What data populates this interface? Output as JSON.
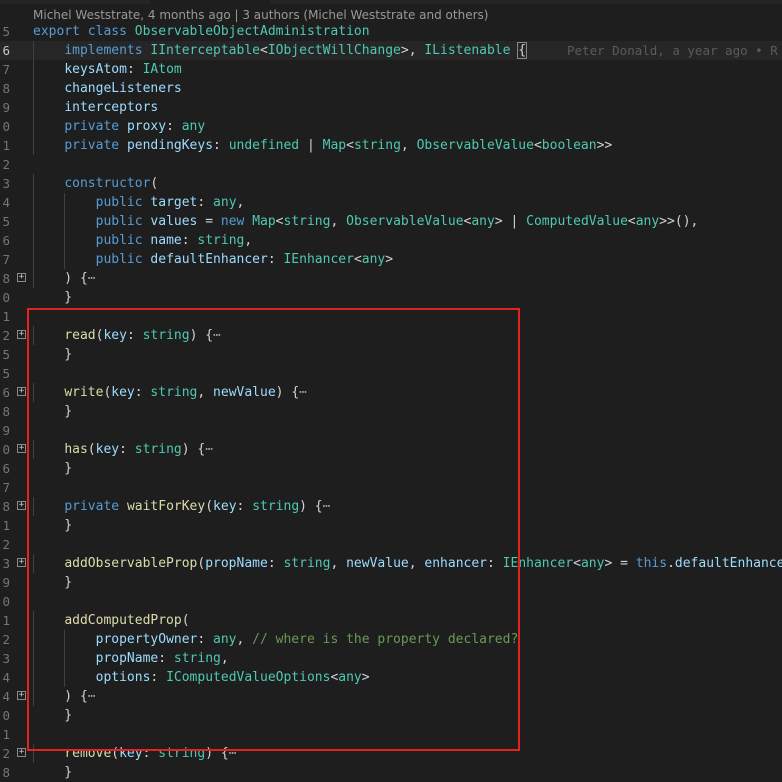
{
  "codelens": {
    "text": "Michel Weststrate, 4 months ago | 3 authors (Michel Weststrate and others)"
  },
  "blame": {
    "text": "Peter Donald, a year ago • R"
  },
  "colors": {
    "highlight_box": "#e52222",
    "background": "#1e1e1e"
  },
  "lines": [
    {
      "num": "5",
      "fold": false,
      "tokens": [
        [
          "k",
          "export "
        ],
        [
          "k",
          "class "
        ],
        [
          "t",
          "ObservableObjectAdministration"
        ]
      ]
    },
    {
      "num": "6",
      "fold": false,
      "current": true,
      "tokens": [
        [
          "p",
          "    "
        ],
        [
          "k",
          "implements "
        ],
        [
          "t",
          "IInterceptable"
        ],
        [
          "p",
          "<"
        ],
        [
          "t",
          "IObjectWillChange"
        ],
        [
          "p",
          ">, "
        ],
        [
          "t",
          "IListenable "
        ],
        [
          "cur",
          "{"
        ]
      ]
    },
    {
      "num": "7",
      "fold": false,
      "tokens": [
        [
          "p",
          "    "
        ],
        [
          "v",
          "keysAtom"
        ],
        [
          "p",
          ": "
        ],
        [
          "t",
          "IAtom"
        ]
      ]
    },
    {
      "num": "8",
      "fold": false,
      "tokens": [
        [
          "p",
          "    "
        ],
        [
          "v",
          "changeListeners"
        ]
      ]
    },
    {
      "num": "9",
      "fold": false,
      "tokens": [
        [
          "p",
          "    "
        ],
        [
          "v",
          "interceptors"
        ]
      ]
    },
    {
      "num": "0",
      "fold": false,
      "tokens": [
        [
          "p",
          "    "
        ],
        [
          "k",
          "private "
        ],
        [
          "v",
          "proxy"
        ],
        [
          "p",
          ": "
        ],
        [
          "t",
          "any"
        ]
      ]
    },
    {
      "num": "1",
      "fold": false,
      "tokens": [
        [
          "p",
          "    "
        ],
        [
          "k",
          "private "
        ],
        [
          "v",
          "pendingKeys"
        ],
        [
          "p",
          ": "
        ],
        [
          "t",
          "undefined"
        ],
        [
          "p",
          " | "
        ],
        [
          "t",
          "Map"
        ],
        [
          "p",
          "<"
        ],
        [
          "t",
          "string"
        ],
        [
          "p",
          ", "
        ],
        [
          "t",
          "ObservableValue"
        ],
        [
          "p",
          "<"
        ],
        [
          "t",
          "boolean"
        ],
        [
          "p",
          ">>"
        ]
      ]
    },
    {
      "num": "2",
      "fold": false,
      "tokens": []
    },
    {
      "num": "3",
      "fold": false,
      "tokens": [
        [
          "p",
          "    "
        ],
        [
          "k",
          "constructor"
        ],
        [
          "p",
          "("
        ]
      ]
    },
    {
      "num": "4",
      "fold": false,
      "tokens": [
        [
          "p",
          "        "
        ],
        [
          "k",
          "public "
        ],
        [
          "v",
          "target"
        ],
        [
          "p",
          ": "
        ],
        [
          "t",
          "any"
        ],
        [
          "p",
          ","
        ]
      ]
    },
    {
      "num": "5",
      "fold": false,
      "tokens": [
        [
          "p",
          "        "
        ],
        [
          "k",
          "public "
        ],
        [
          "v",
          "values"
        ],
        [
          "p",
          " = "
        ],
        [
          "k",
          "new "
        ],
        [
          "t",
          "Map"
        ],
        [
          "p",
          "<"
        ],
        [
          "t",
          "string"
        ],
        [
          "p",
          ", "
        ],
        [
          "t",
          "ObservableValue"
        ],
        [
          "p",
          "<"
        ],
        [
          "t",
          "any"
        ],
        [
          "p",
          "> | "
        ],
        [
          "t",
          "ComputedValue"
        ],
        [
          "p",
          "<"
        ],
        [
          "t",
          "any"
        ],
        [
          "p",
          ">>(),"
        ]
      ]
    },
    {
      "num": "6",
      "fold": false,
      "tokens": [
        [
          "p",
          "        "
        ],
        [
          "k",
          "public "
        ],
        [
          "v",
          "name"
        ],
        [
          "p",
          ": "
        ],
        [
          "t",
          "string"
        ],
        [
          "p",
          ","
        ]
      ]
    },
    {
      "num": "7",
      "fold": false,
      "tokens": [
        [
          "p",
          "        "
        ],
        [
          "k",
          "public "
        ],
        [
          "v",
          "defaultEnhancer"
        ],
        [
          "p",
          ": "
        ],
        [
          "t",
          "IEnhancer"
        ],
        [
          "p",
          "<"
        ],
        [
          "t",
          "any"
        ],
        [
          "p",
          ">"
        ]
      ]
    },
    {
      "num": "8",
      "fold": true,
      "tokens": [
        [
          "p",
          "    ) {"
        ],
        [
          "ell",
          "⋯"
        ]
      ]
    },
    {
      "num": "0",
      "fold": false,
      "tokens": [
        [
          "p",
          "    }"
        ]
      ]
    },
    {
      "num": "1",
      "fold": false,
      "tokens": []
    },
    {
      "num": "2",
      "fold": true,
      "tokens": [
        [
          "p",
          "    "
        ],
        [
          "f",
          "read"
        ],
        [
          "p",
          "("
        ],
        [
          "v",
          "key"
        ],
        [
          "p",
          ": "
        ],
        [
          "t",
          "string"
        ],
        [
          "p",
          ") {"
        ],
        [
          "ell",
          "⋯"
        ]
      ]
    },
    {
      "num": "5",
      "fold": false,
      "tokens": [
        [
          "p",
          "    }"
        ]
      ]
    },
    {
      "num": "5",
      "fold": false,
      "tokens": []
    },
    {
      "num": "6",
      "fold": true,
      "tokens": [
        [
          "p",
          "    "
        ],
        [
          "f",
          "write"
        ],
        [
          "p",
          "("
        ],
        [
          "v",
          "key"
        ],
        [
          "p",
          ": "
        ],
        [
          "t",
          "string"
        ],
        [
          "p",
          ", "
        ],
        [
          "v",
          "newValue"
        ],
        [
          "p",
          ") {"
        ],
        [
          "ell",
          "⋯"
        ]
      ]
    },
    {
      "num": "8",
      "fold": false,
      "tokens": [
        [
          "p",
          "    }"
        ]
      ]
    },
    {
      "num": "9",
      "fold": false,
      "tokens": []
    },
    {
      "num": "0",
      "fold": true,
      "tokens": [
        [
          "p",
          "    "
        ],
        [
          "f",
          "has"
        ],
        [
          "p",
          "("
        ],
        [
          "v",
          "key"
        ],
        [
          "p",
          ": "
        ],
        [
          "t",
          "string"
        ],
        [
          "p",
          ") {"
        ],
        [
          "ell",
          "⋯"
        ]
      ]
    },
    {
      "num": "6",
      "fold": false,
      "tokens": [
        [
          "p",
          "    }"
        ]
      ]
    },
    {
      "num": "7",
      "fold": false,
      "tokens": []
    },
    {
      "num": "8",
      "fold": true,
      "tokens": [
        [
          "p",
          "    "
        ],
        [
          "k",
          "private "
        ],
        [
          "f",
          "waitForKey"
        ],
        [
          "p",
          "("
        ],
        [
          "v",
          "key"
        ],
        [
          "p",
          ": "
        ],
        [
          "t",
          "string"
        ],
        [
          "p",
          ") {"
        ],
        [
          "ell",
          "⋯"
        ]
      ]
    },
    {
      "num": "1",
      "fold": false,
      "tokens": [
        [
          "p",
          "    }"
        ]
      ]
    },
    {
      "num": "2",
      "fold": false,
      "tokens": []
    },
    {
      "num": "3",
      "fold": true,
      "tokens": [
        [
          "p",
          "    "
        ],
        [
          "f",
          "addObservableProp"
        ],
        [
          "p",
          "("
        ],
        [
          "v",
          "propName"
        ],
        [
          "p",
          ": "
        ],
        [
          "t",
          "string"
        ],
        [
          "p",
          ", "
        ],
        [
          "v",
          "newValue"
        ],
        [
          "p",
          ", "
        ],
        [
          "v",
          "enhancer"
        ],
        [
          "p",
          ": "
        ],
        [
          "t",
          "IEnhancer"
        ],
        [
          "p",
          "<"
        ],
        [
          "t",
          "any"
        ],
        [
          "p",
          "> = "
        ],
        [
          "k",
          "this"
        ],
        [
          "p",
          "."
        ],
        [
          "v",
          "defaultEnhancer"
        ],
        [
          "p",
          ")"
        ]
      ]
    },
    {
      "num": "9",
      "fold": false,
      "tokens": [
        [
          "p",
          "    }"
        ]
      ]
    },
    {
      "num": "0",
      "fold": false,
      "tokens": []
    },
    {
      "num": "1",
      "fold": false,
      "tokens": [
        [
          "p",
          "    "
        ],
        [
          "f",
          "addComputedProp"
        ],
        [
          "p",
          "("
        ]
      ]
    },
    {
      "num": "2",
      "fold": false,
      "tokens": [
        [
          "p",
          "        "
        ],
        [
          "v",
          "propertyOwner"
        ],
        [
          "p",
          ": "
        ],
        [
          "t",
          "any"
        ],
        [
          "p",
          ", "
        ],
        [
          "c",
          "// where is the property declared?"
        ]
      ]
    },
    {
      "num": "3",
      "fold": false,
      "tokens": [
        [
          "p",
          "        "
        ],
        [
          "v",
          "propName"
        ],
        [
          "p",
          ": "
        ],
        [
          "t",
          "string"
        ],
        [
          "p",
          ","
        ]
      ]
    },
    {
      "num": "4",
      "fold": false,
      "tokens": [
        [
          "p",
          "        "
        ],
        [
          "v",
          "options"
        ],
        [
          "p",
          ": "
        ],
        [
          "t",
          "IComputedValueOptions"
        ],
        [
          "p",
          "<"
        ],
        [
          "t",
          "any"
        ],
        [
          "p",
          ">"
        ]
      ]
    },
    {
      "num": "4",
      "fold": true,
      "tokens": [
        [
          "p",
          "    ) {"
        ],
        [
          "ell",
          "⋯"
        ]
      ]
    },
    {
      "num": "0",
      "fold": false,
      "tokens": [
        [
          "p",
          "    }"
        ]
      ]
    },
    {
      "num": "1",
      "fold": false,
      "tokens": []
    },
    {
      "num": "2",
      "fold": true,
      "tokens": [
        [
          "p",
          "    "
        ],
        [
          "f",
          "remove"
        ],
        [
          "p",
          "("
        ],
        [
          "v",
          "key"
        ],
        [
          "p",
          ": "
        ],
        [
          "t",
          "string"
        ],
        [
          "p",
          ") {"
        ],
        [
          "ell",
          "⋯"
        ]
      ]
    },
    {
      "num": "8",
      "fold": false,
      "tokens": [
        [
          "p",
          "    }"
        ]
      ]
    }
  ]
}
